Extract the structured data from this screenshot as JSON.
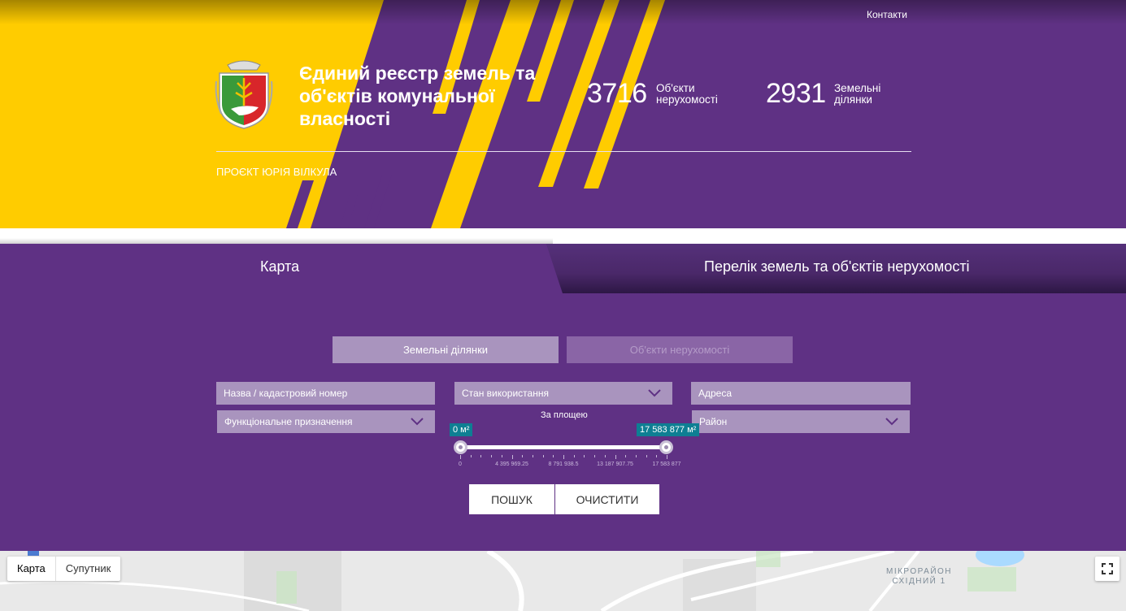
{
  "header": {
    "contacts_link": "Контакти",
    "title": "Єдиний реєстр земель та об'єктів комунальної власності",
    "stats": [
      {
        "value": "3716",
        "label": "Об'єкти нерухомості"
      },
      {
        "value": "2931",
        "label": "Земельні ділянки"
      }
    ],
    "project": "ПРОЄКТ ЮРІЯ ВІЛКУЛА"
  },
  "tabs": {
    "map": "Карта",
    "list": "Перелік земель та об'єктів нерухомості"
  },
  "filters": {
    "toggle_land": "Земельні ділянки",
    "toggle_objects": "Об'єкти нерухомості",
    "name_placeholder": "Назва / кадастровий номер",
    "usage_state": "Стан використання",
    "address_placeholder": "Адреса",
    "functional_purpose": "Функціональне призначення",
    "district": "Район",
    "area_label": "За площею",
    "area_min_badge": "0 м²",
    "area_max_badge": "17 583 877 м²",
    "area_min": 0,
    "area_max": 17583877,
    "ticks": [
      "0",
      "4 395 969.25",
      "8 791 938.5",
      "13 187 907.75",
      "17 583 877"
    ]
  },
  "buttons": {
    "search": "ПОШУК",
    "clear": "ОЧИСТИТИ"
  },
  "map": {
    "map_type_map": "Карта",
    "map_type_satellite": "Супутник",
    "area_label_1": "МІКРОРАЙОН",
    "area_label_2": "СХІДНИЙ 1"
  },
  "colors": {
    "purple": "#5f3184",
    "yellow": "#ffcc00",
    "field": "#a994be",
    "badge": "#0e7f93"
  }
}
